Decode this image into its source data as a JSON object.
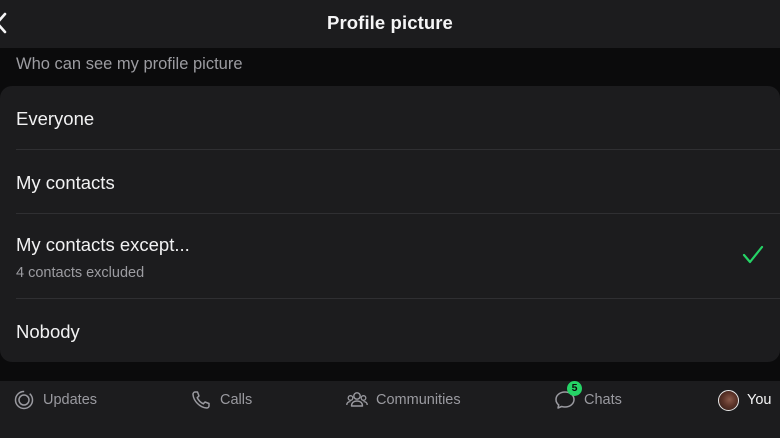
{
  "header": {
    "title": "Profile picture",
    "back_icon": "chevron-left-icon"
  },
  "section": {
    "label": "Who can see my profile picture"
  },
  "options": [
    {
      "label": "Everyone",
      "selected": false
    },
    {
      "label": "My contacts",
      "selected": false
    },
    {
      "label": "My contacts except...",
      "sublabel": "4 contacts excluded",
      "selected": true
    },
    {
      "label": "Nobody",
      "selected": false
    }
  ],
  "tabbar": {
    "tabs": [
      {
        "label": "Updates",
        "icon": "updates-icon"
      },
      {
        "label": "Calls",
        "icon": "phone-icon"
      },
      {
        "label": "Communities",
        "icon": "communities-icon"
      },
      {
        "label": "Chats",
        "icon": "chat-icon",
        "badge": "5"
      },
      {
        "label": "You",
        "icon": "avatar"
      }
    ]
  },
  "colors": {
    "accent": "#25d366",
    "background": "#0b0b0c",
    "surface": "#1c1c1e"
  }
}
